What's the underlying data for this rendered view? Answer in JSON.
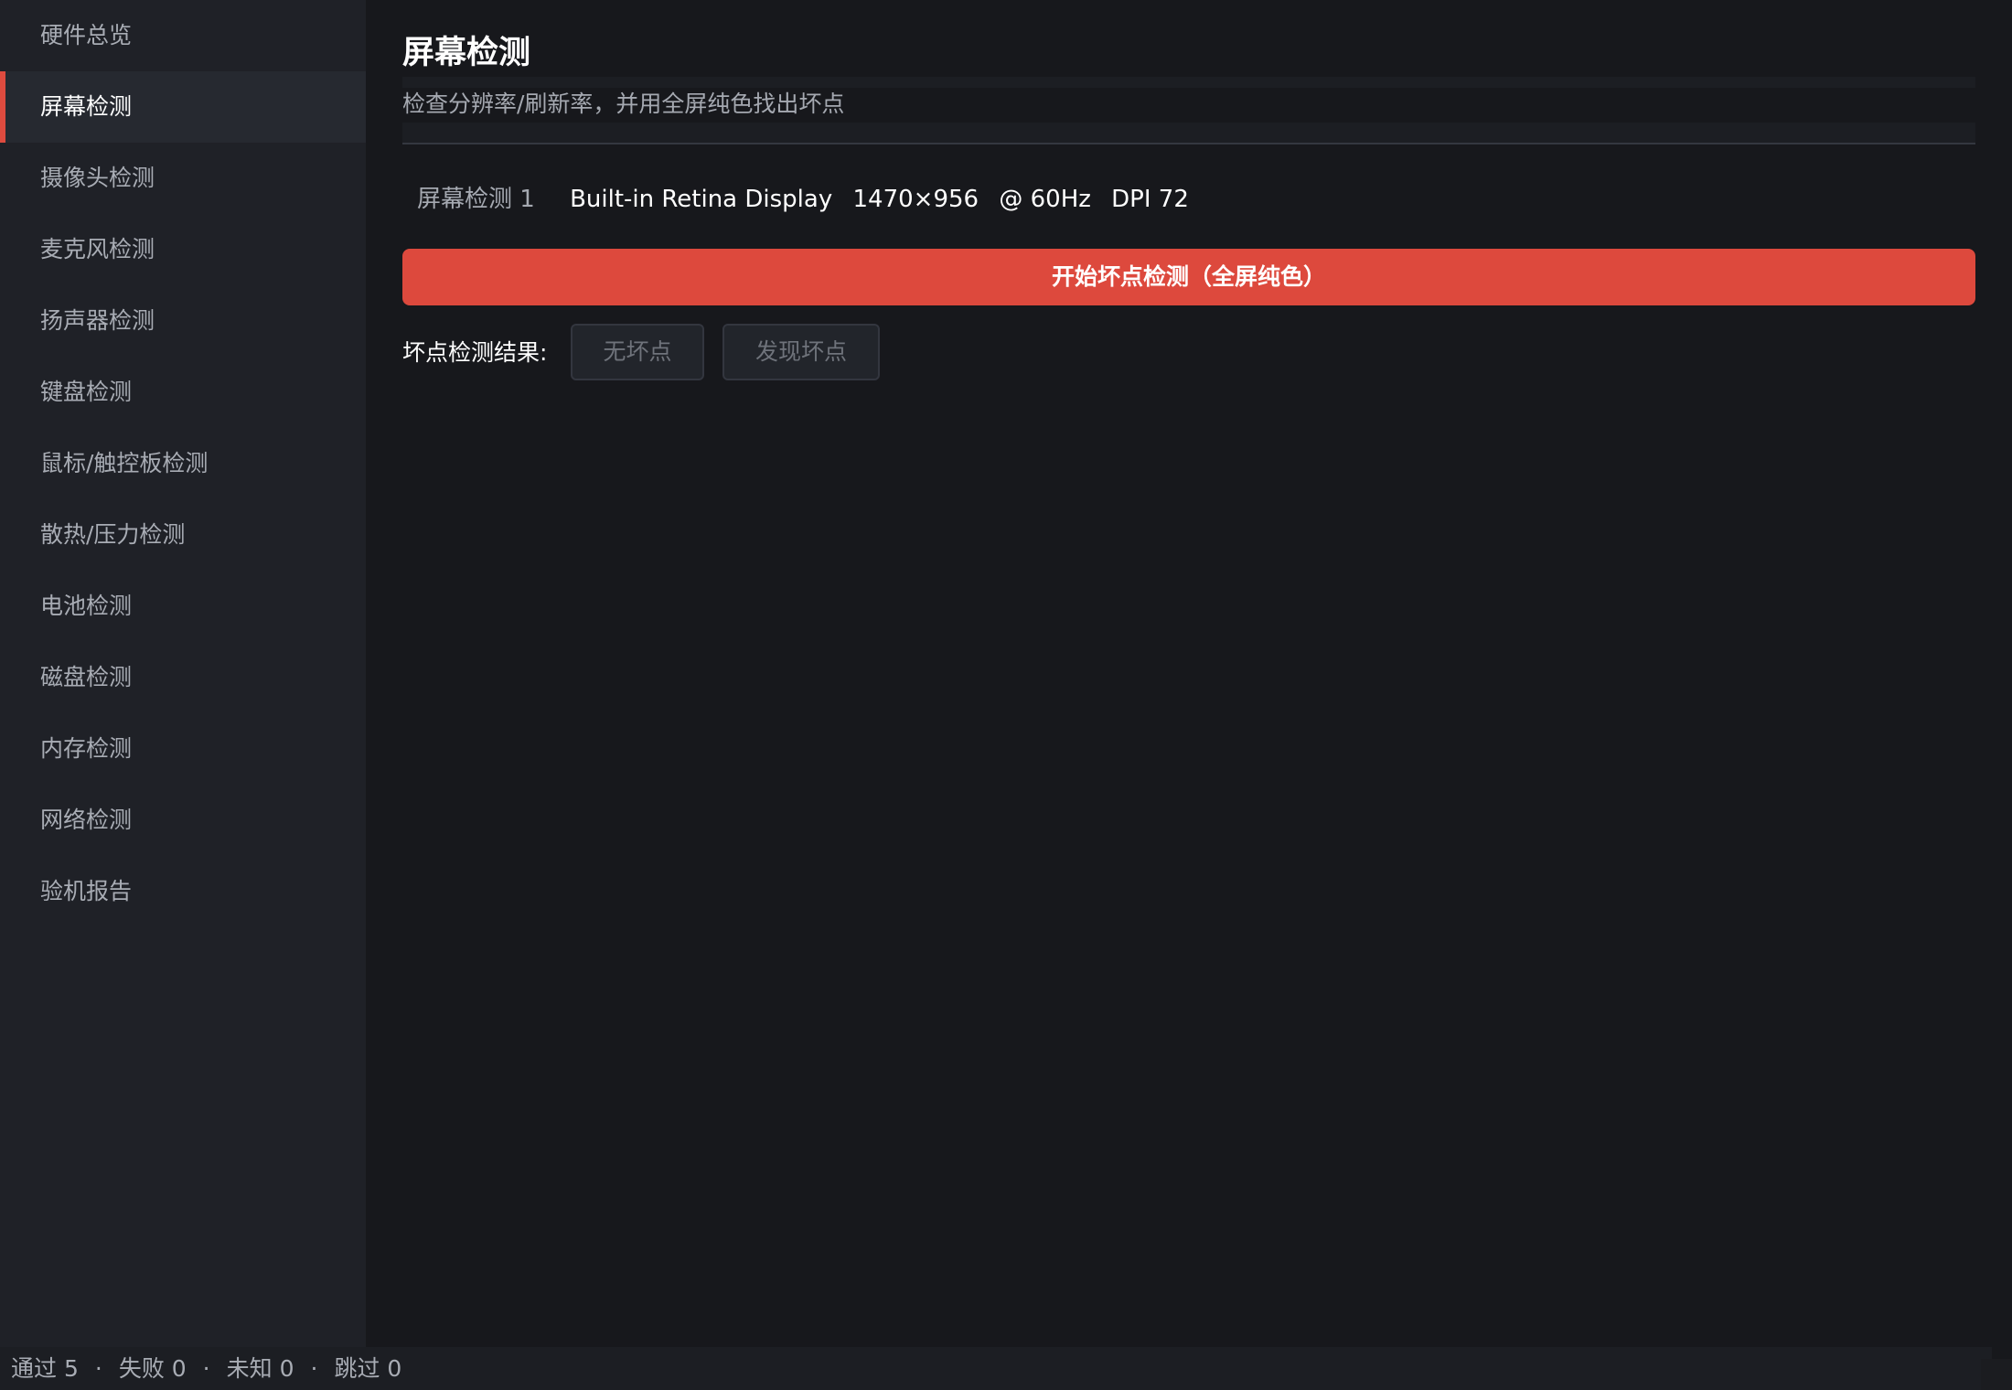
{
  "sidebar": {
    "items": [
      {
        "label": "硬件总览"
      },
      {
        "label": "屏幕检测"
      },
      {
        "label": "摄像头检测"
      },
      {
        "label": "麦克风检测"
      },
      {
        "label": "扬声器检测"
      },
      {
        "label": "键盘检测"
      },
      {
        "label": "鼠标/触控板检测"
      },
      {
        "label": "散热/压力检测"
      },
      {
        "label": "电池检测"
      },
      {
        "label": "磁盘检测"
      },
      {
        "label": "内存检测"
      },
      {
        "label": "网络检测"
      },
      {
        "label": "验机报告"
      }
    ],
    "active_index": 1
  },
  "main": {
    "title": "屏幕检测",
    "subtitle": "检查分辨率/刷新率，并用全屏纯色找出坏点",
    "display": {
      "label": "屏幕检测 1",
      "name": "Built-in Retina Display",
      "resolution": "1470×956",
      "refresh": "@ 60Hz",
      "dpi": "DPI 72"
    },
    "start_button": "开始坏点检测（全屏纯色）",
    "result_label": "坏点检测结果:",
    "result_buttons": {
      "no_dead": "无坏点",
      "found_dead": "发现坏点"
    }
  },
  "status_bar": {
    "passed": "通过 5",
    "failed": "失败 0",
    "unknown": "未知 0",
    "skipped": "跳过 0",
    "separator": "·"
  },
  "colors": {
    "accent": "#dd493d",
    "background": "#17181c",
    "sidebar": "#1f2127"
  }
}
